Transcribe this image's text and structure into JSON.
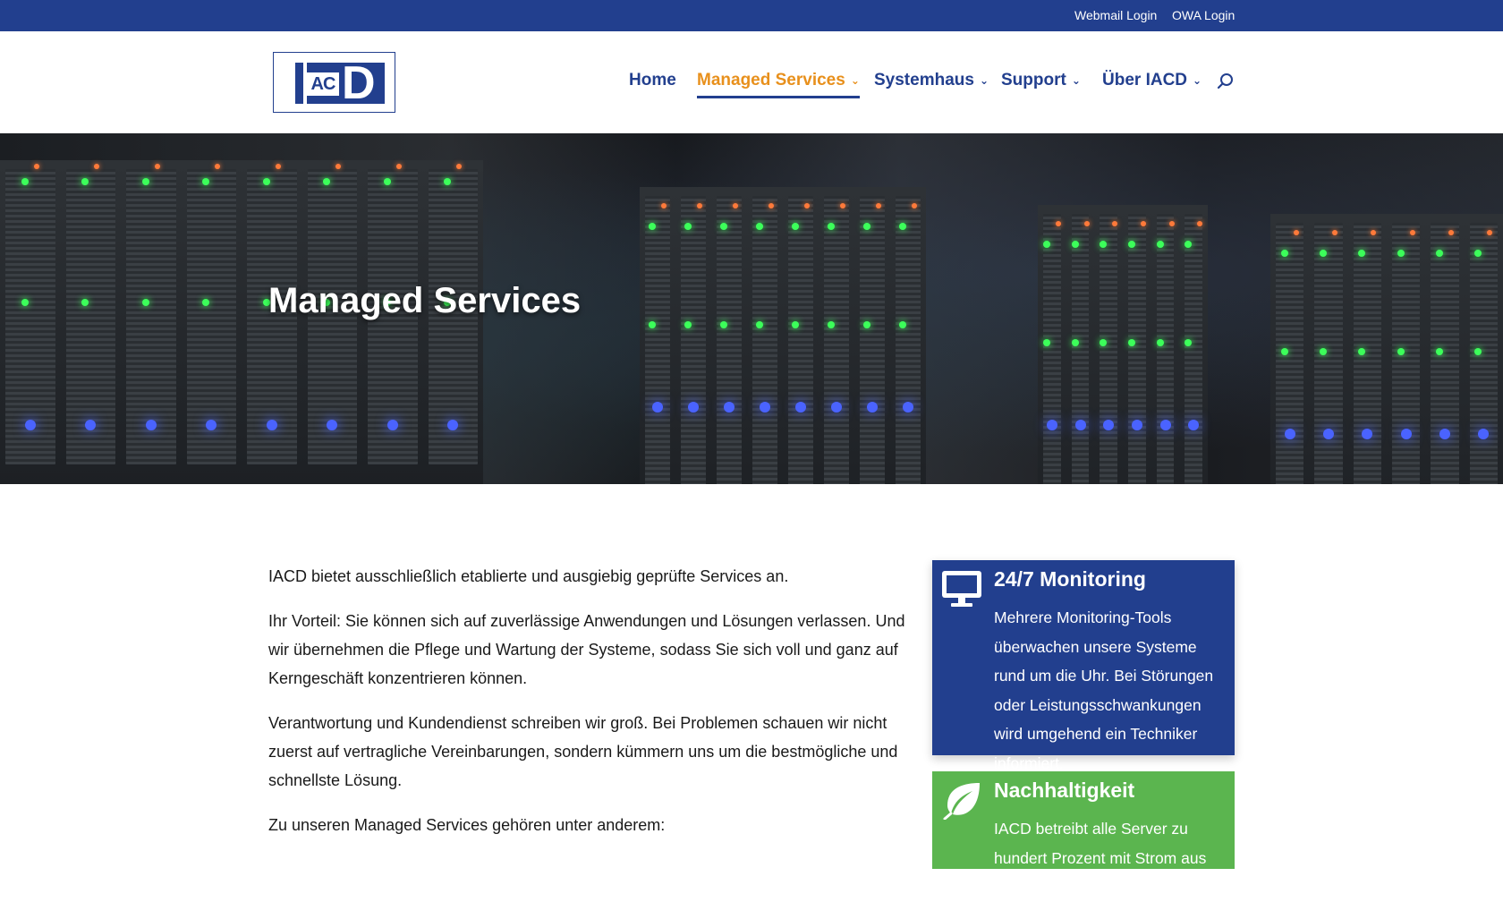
{
  "topbar": {
    "webmail": "Webmail Login",
    "owa": "OWA Login"
  },
  "logo": {
    "ac": "AC",
    "d": "D"
  },
  "nav": [
    {
      "label": "Home",
      "chevron": false,
      "active": false
    },
    {
      "label": "Managed Services",
      "chevron": true,
      "active": true
    },
    {
      "label": "Systemhaus",
      "chevron": true,
      "active": false
    },
    {
      "label": "Support",
      "chevron": true,
      "active": false
    },
    {
      "label": "Über IACD",
      "chevron": true,
      "active": false
    }
  ],
  "hero": {
    "title": "Managed Services"
  },
  "content": {
    "p1": "IACD bietet ausschließlich etablierte und ausgiebig geprüfte Services an.",
    "p2": "Ihr Vorteil: Sie können sich auf zuverlässige Anwendungen und Lösungen verlassen. Und wir übernehmen die Pflege und Wartung der Systeme, sodass Sie sich voll und ganz auf Kerngeschäft konzentrieren können.",
    "p3": "Verantwortung und Kundendienst schreiben wir groß. Bei Problemen schauen wir nicht zuerst auf vertragliche Vereinbarungen, sondern kümmern uns um die bestmögliche und schnellste Lösung.",
    "p4": "Zu unseren Managed Services gehören unter anderem:"
  },
  "cards": {
    "monitoring": {
      "title": "24/7 Monitoring",
      "text": "Mehrere Monitoring-Tools überwachen unsere Systeme rund um die Uhr. Bei Störungen oder Leistungsschwankungen wird umgehend ein Techniker informiert."
    },
    "sustainability": {
      "title": "Nachhaltigkeit",
      "text": "IACD betreibt alle Server zu hundert Prozent mit Strom aus erneu-"
    }
  },
  "colors": {
    "primary": "#223f8e",
    "accent": "#e8901c",
    "green": "#5bb54f"
  }
}
